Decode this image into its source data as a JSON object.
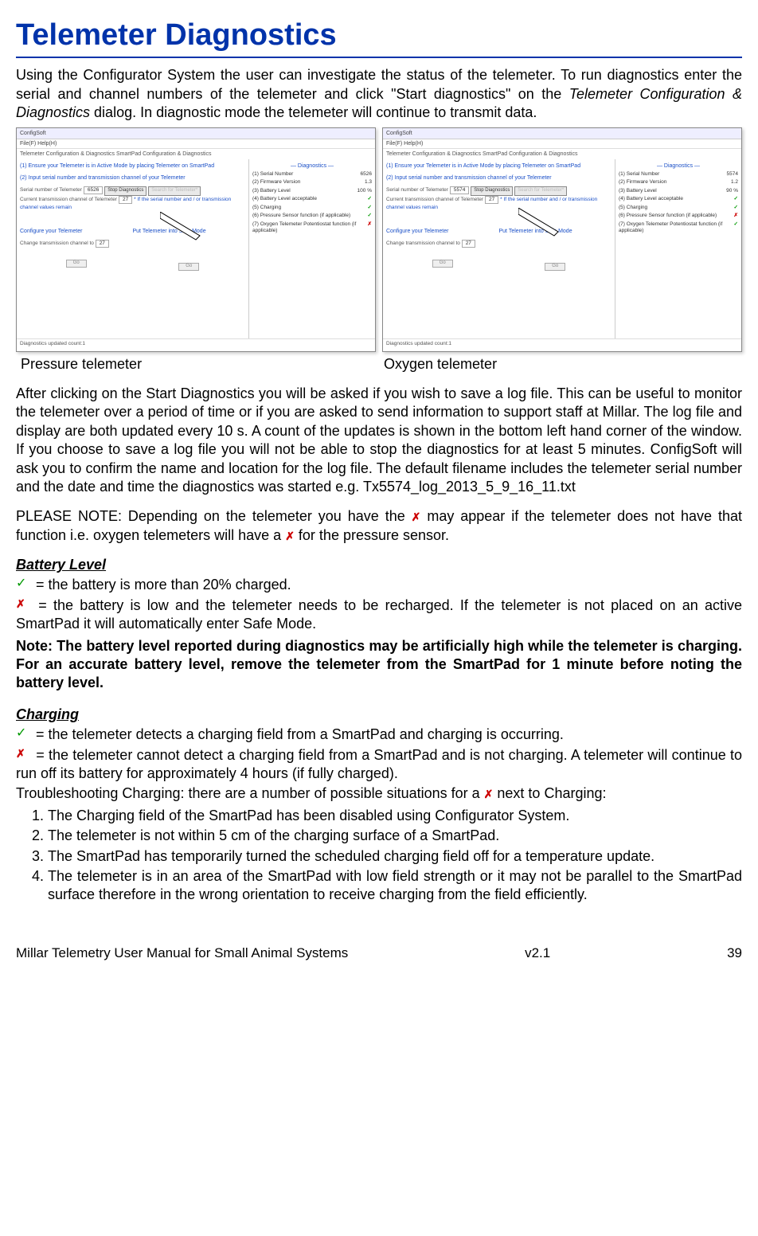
{
  "title": "Telemeter Diagnostics",
  "intro_part1": "Using the Configurator System the user can investigate the status of the telemeter.  To run diagnostics enter the serial and channel numbers of the telemeter and click \"Start diagnostics\" on the ",
  "intro_ital": "Telemeter Configuration & Diagnostics",
  "intro_part2": " dialog.  In diagnostic mode the telemeter will continue to transmit data.",
  "shot_common": {
    "winbar": "ConfigSoft",
    "menu": "File(F)   Help(H)",
    "tabs": "Telemeter Configuration & Diagnostics    SmartPad Configuration & Diagnostics",
    "instr1": "(1) Ensure your Telemeter is in Active Mode by placing Telemeter on SmartPad",
    "instr2": "(2) Input serial number and transmission channel of your Telemeter",
    "serial_lbl": "Serial number of Telemeter",
    "chan_lbl": "Current transmission channel of Telemeter",
    "stop_btn": "Stop Diagnostics",
    "search_btn": "Search for Telemeter*",
    "hint": "* If the serial number and / or transmission channel values remain",
    "config_head": "Configure your Telemeter",
    "safe_head": "Put Telemeter into Safe Mode",
    "change_lbl": "Change transmission channel to",
    "go": "Go",
    "diag_head": "— Diagnostics —",
    "d1": "(1) Serial Number",
    "d2": "(2) Firmware Version",
    "d3": "(3) Battery Level",
    "d4": "(4) Battery Level acceptable",
    "d5": "(5) Charging",
    "d6": "(6) Pressure Sensor function (if applicable)",
    "d7": "(7) Oxygen Telemeter Potentiostat function (if applicable)",
    "footer": "Diagnostics updated count:1"
  },
  "shot_left": {
    "serial": "6526",
    "fw": "1.3",
    "bat": "100",
    "d4": "✓",
    "d5": "✓",
    "d6": "✓",
    "d7": "✗",
    "chan": "27"
  },
  "shot_right": {
    "serial": "5574",
    "fw": "1.2",
    "bat": "90",
    "d4": "✓",
    "d5": "✓",
    "d6": "✗",
    "d7": "✓",
    "chan": "27"
  },
  "caption_left": "Pressure telemeter",
  "caption_right": "Oxygen telemeter",
  "para_after": "After clicking on the Start Diagnostics you will be asked if you wish to save a log file.  This can be useful to monitor the telemeter over a period of time or if you are asked to send information to support staff at Millar. The log file and display are both updated every 10 s. A count of the updates is shown in the bottom left hand corner of the window. If you choose to save a log file you will not be able to stop the diagnostics for at least 5 minutes. ConfigSoft will ask you to confirm the name and location for the log file. The default filename includes the telemeter serial number and the date and time the diagnostics was started e.g. Tx5574_log_2013_5_9_16_11.txt",
  "please_note_1": "PLEASE NOTE: Depending on the telemeter you have the ",
  "please_note_2": " may appear if the telemeter does not have that function i.e. oxygen telemeters will have a ",
  "please_note_3": " for the pressure sensor.",
  "battery_head": "Battery Level",
  "battery_ok": " = the battery is more than 20% charged.",
  "battery_bad": " = the battery is low and the telemeter needs to be recharged.  If the telemeter is not placed on an active SmartPad it will automatically enter Safe Mode.",
  "battery_note": "Note: The battery level reported during diagnostics may be artificially high while the telemeter is charging.  For an accurate battery level, remove the telemeter from the SmartPad for 1 minute before noting the battery level.",
  "charging_head": "Charging",
  "charging_ok": " = the telemeter detects a charging field from a SmartPad and charging is occurring.",
  "charging_bad": " = the telemeter cannot detect a charging field from a SmartPad and is not charging.  A telemeter will continue to run off its battery for approximately 4 hours (if fully charged).",
  "trouble_intro_1": "Troubleshooting Charging: there are a number of possible situations for a ",
  "trouble_intro_2": " next to Charging:",
  "trouble_items": [
    "The Charging field of the SmartPad has been disabled using Configurator System.",
    "The telemeter is not within 5 cm of the charging surface of a SmartPad.",
    "The SmartPad has temporarily turned the scheduled charging field off for a temperature update.",
    "The telemeter is in an area of the SmartPad with low field strength or it may not be parallel to the SmartPad surface therefore in the wrong orientation to receive charging from the field efficiently."
  ],
  "footer_left": "Millar Telemetry User Manual for Small Animal Systems",
  "footer_mid": "v2.1",
  "footer_right": "39"
}
